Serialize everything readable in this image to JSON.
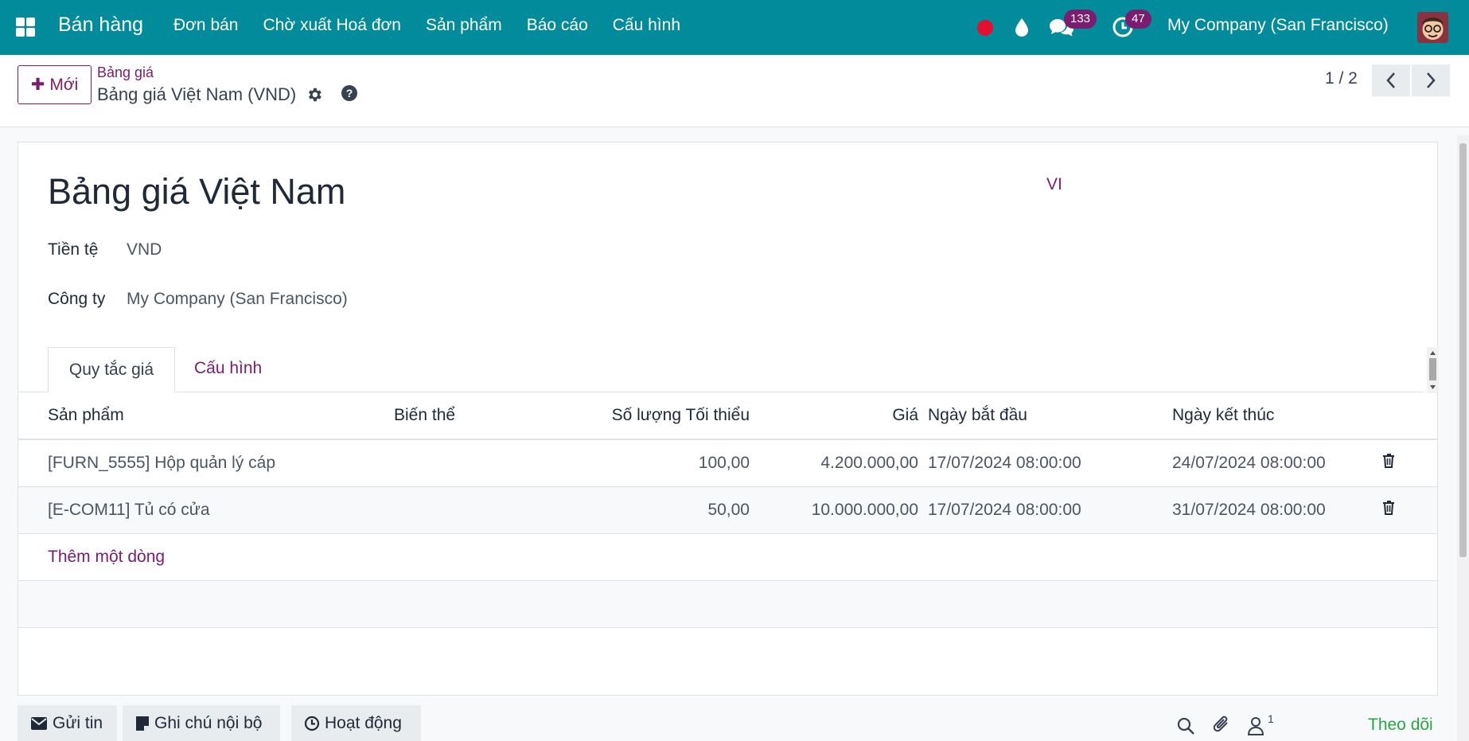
{
  "navbar": {
    "brand": "Bán hàng",
    "menu": [
      "Đơn bán",
      "Chờ xuất Hoá đơn",
      "Sản phẩm",
      "Báo cáo",
      "Cấu hình"
    ],
    "messages_count": "133",
    "activities_count": "47",
    "company": "My Company (San Francisco)"
  },
  "control": {
    "new_label": "Mới",
    "breadcrumb_parent": "Bảng giá",
    "breadcrumb_current": "Bảng giá Việt Nam (VND)",
    "pager": "1 / 2"
  },
  "form": {
    "title": "Bảng giá Việt Nam",
    "lang": "VI",
    "currency_label": "Tiền tệ",
    "currency_value": "VND",
    "company_label": "Công ty",
    "company_value": "My Company (San Francisco)"
  },
  "tabs": [
    "Quy tắc giá",
    "Cấu hình"
  ],
  "table": {
    "headers": [
      "Sản phẩm",
      "Biến thể",
      "Số lượng Tối thiểu",
      "Giá",
      "Ngày bắt đầu",
      "Ngày kết thúc"
    ],
    "rows": [
      {
        "product": "[FURN_5555] Hộp quản lý cáp",
        "variant": "",
        "min_qty": "100,00",
        "price": "4.200.000,00",
        "start": "17/07/2024 08:00:00",
        "end": "24/07/2024 08:00:00"
      },
      {
        "product": "[E-COM11] Tủ có cửa",
        "variant": "",
        "min_qty": "50,00",
        "price": "10.000.000,00",
        "start": "17/07/2024 08:00:00",
        "end": "31/07/2024 08:00:00"
      }
    ],
    "add_line": "Thêm một dòng"
  },
  "chatter": {
    "send_message": "Gửi tin",
    "log_note": "Ghi chú nội bộ",
    "activities": "Hoạt động",
    "followers_count": "1",
    "follow": "Theo dõi"
  },
  "colors": {
    "navbar": "#018b9b",
    "primary": "#7a1c6f",
    "record_dot": "#e3112f",
    "follow": "#28a745"
  }
}
